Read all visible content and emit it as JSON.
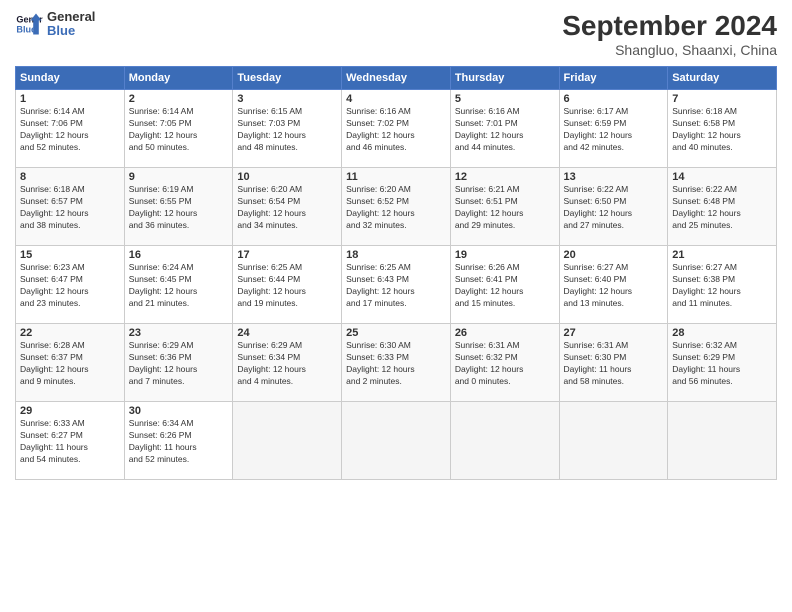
{
  "header": {
    "logo_line1": "General",
    "logo_line2": "Blue",
    "month": "September 2024",
    "location": "Shangluo, Shaanxi, China"
  },
  "weekdays": [
    "Sunday",
    "Monday",
    "Tuesday",
    "Wednesday",
    "Thursday",
    "Friday",
    "Saturday"
  ],
  "weeks": [
    [
      {
        "day": "1",
        "lines": [
          "Sunrise: 6:14 AM",
          "Sunset: 7:06 PM",
          "Daylight: 12 hours",
          "and 52 minutes."
        ]
      },
      {
        "day": "2",
        "lines": [
          "Sunrise: 6:14 AM",
          "Sunset: 7:05 PM",
          "Daylight: 12 hours",
          "and 50 minutes."
        ]
      },
      {
        "day": "3",
        "lines": [
          "Sunrise: 6:15 AM",
          "Sunset: 7:03 PM",
          "Daylight: 12 hours",
          "and 48 minutes."
        ]
      },
      {
        "day": "4",
        "lines": [
          "Sunrise: 6:16 AM",
          "Sunset: 7:02 PM",
          "Daylight: 12 hours",
          "and 46 minutes."
        ]
      },
      {
        "day": "5",
        "lines": [
          "Sunrise: 6:16 AM",
          "Sunset: 7:01 PM",
          "Daylight: 12 hours",
          "and 44 minutes."
        ]
      },
      {
        "day": "6",
        "lines": [
          "Sunrise: 6:17 AM",
          "Sunset: 6:59 PM",
          "Daylight: 12 hours",
          "and 42 minutes."
        ]
      },
      {
        "day": "7",
        "lines": [
          "Sunrise: 6:18 AM",
          "Sunset: 6:58 PM",
          "Daylight: 12 hours",
          "and 40 minutes."
        ]
      }
    ],
    [
      {
        "day": "8",
        "lines": [
          "Sunrise: 6:18 AM",
          "Sunset: 6:57 PM",
          "Daylight: 12 hours",
          "and 38 minutes."
        ]
      },
      {
        "day": "9",
        "lines": [
          "Sunrise: 6:19 AM",
          "Sunset: 6:55 PM",
          "Daylight: 12 hours",
          "and 36 minutes."
        ]
      },
      {
        "day": "10",
        "lines": [
          "Sunrise: 6:20 AM",
          "Sunset: 6:54 PM",
          "Daylight: 12 hours",
          "and 34 minutes."
        ]
      },
      {
        "day": "11",
        "lines": [
          "Sunrise: 6:20 AM",
          "Sunset: 6:52 PM",
          "Daylight: 12 hours",
          "and 32 minutes."
        ]
      },
      {
        "day": "12",
        "lines": [
          "Sunrise: 6:21 AM",
          "Sunset: 6:51 PM",
          "Daylight: 12 hours",
          "and 29 minutes."
        ]
      },
      {
        "day": "13",
        "lines": [
          "Sunrise: 6:22 AM",
          "Sunset: 6:50 PM",
          "Daylight: 12 hours",
          "and 27 minutes."
        ]
      },
      {
        "day": "14",
        "lines": [
          "Sunrise: 6:22 AM",
          "Sunset: 6:48 PM",
          "Daylight: 12 hours",
          "and 25 minutes."
        ]
      }
    ],
    [
      {
        "day": "15",
        "lines": [
          "Sunrise: 6:23 AM",
          "Sunset: 6:47 PM",
          "Daylight: 12 hours",
          "and 23 minutes."
        ]
      },
      {
        "day": "16",
        "lines": [
          "Sunrise: 6:24 AM",
          "Sunset: 6:45 PM",
          "Daylight: 12 hours",
          "and 21 minutes."
        ]
      },
      {
        "day": "17",
        "lines": [
          "Sunrise: 6:25 AM",
          "Sunset: 6:44 PM",
          "Daylight: 12 hours",
          "and 19 minutes."
        ]
      },
      {
        "day": "18",
        "lines": [
          "Sunrise: 6:25 AM",
          "Sunset: 6:43 PM",
          "Daylight: 12 hours",
          "and 17 minutes."
        ]
      },
      {
        "day": "19",
        "lines": [
          "Sunrise: 6:26 AM",
          "Sunset: 6:41 PM",
          "Daylight: 12 hours",
          "and 15 minutes."
        ]
      },
      {
        "day": "20",
        "lines": [
          "Sunrise: 6:27 AM",
          "Sunset: 6:40 PM",
          "Daylight: 12 hours",
          "and 13 minutes."
        ]
      },
      {
        "day": "21",
        "lines": [
          "Sunrise: 6:27 AM",
          "Sunset: 6:38 PM",
          "Daylight: 12 hours",
          "and 11 minutes."
        ]
      }
    ],
    [
      {
        "day": "22",
        "lines": [
          "Sunrise: 6:28 AM",
          "Sunset: 6:37 PM",
          "Daylight: 12 hours",
          "and 9 minutes."
        ]
      },
      {
        "day": "23",
        "lines": [
          "Sunrise: 6:29 AM",
          "Sunset: 6:36 PM",
          "Daylight: 12 hours",
          "and 7 minutes."
        ]
      },
      {
        "day": "24",
        "lines": [
          "Sunrise: 6:29 AM",
          "Sunset: 6:34 PM",
          "Daylight: 12 hours",
          "and 4 minutes."
        ]
      },
      {
        "day": "25",
        "lines": [
          "Sunrise: 6:30 AM",
          "Sunset: 6:33 PM",
          "Daylight: 12 hours",
          "and 2 minutes."
        ]
      },
      {
        "day": "26",
        "lines": [
          "Sunrise: 6:31 AM",
          "Sunset: 6:32 PM",
          "Daylight: 12 hours",
          "and 0 minutes."
        ]
      },
      {
        "day": "27",
        "lines": [
          "Sunrise: 6:31 AM",
          "Sunset: 6:30 PM",
          "Daylight: 11 hours",
          "and 58 minutes."
        ]
      },
      {
        "day": "28",
        "lines": [
          "Sunrise: 6:32 AM",
          "Sunset: 6:29 PM",
          "Daylight: 11 hours",
          "and 56 minutes."
        ]
      }
    ],
    [
      {
        "day": "29",
        "lines": [
          "Sunrise: 6:33 AM",
          "Sunset: 6:27 PM",
          "Daylight: 11 hours",
          "and 54 minutes."
        ]
      },
      {
        "day": "30",
        "lines": [
          "Sunrise: 6:34 AM",
          "Sunset: 6:26 PM",
          "Daylight: 11 hours",
          "and 52 minutes."
        ]
      },
      null,
      null,
      null,
      null,
      null
    ]
  ]
}
